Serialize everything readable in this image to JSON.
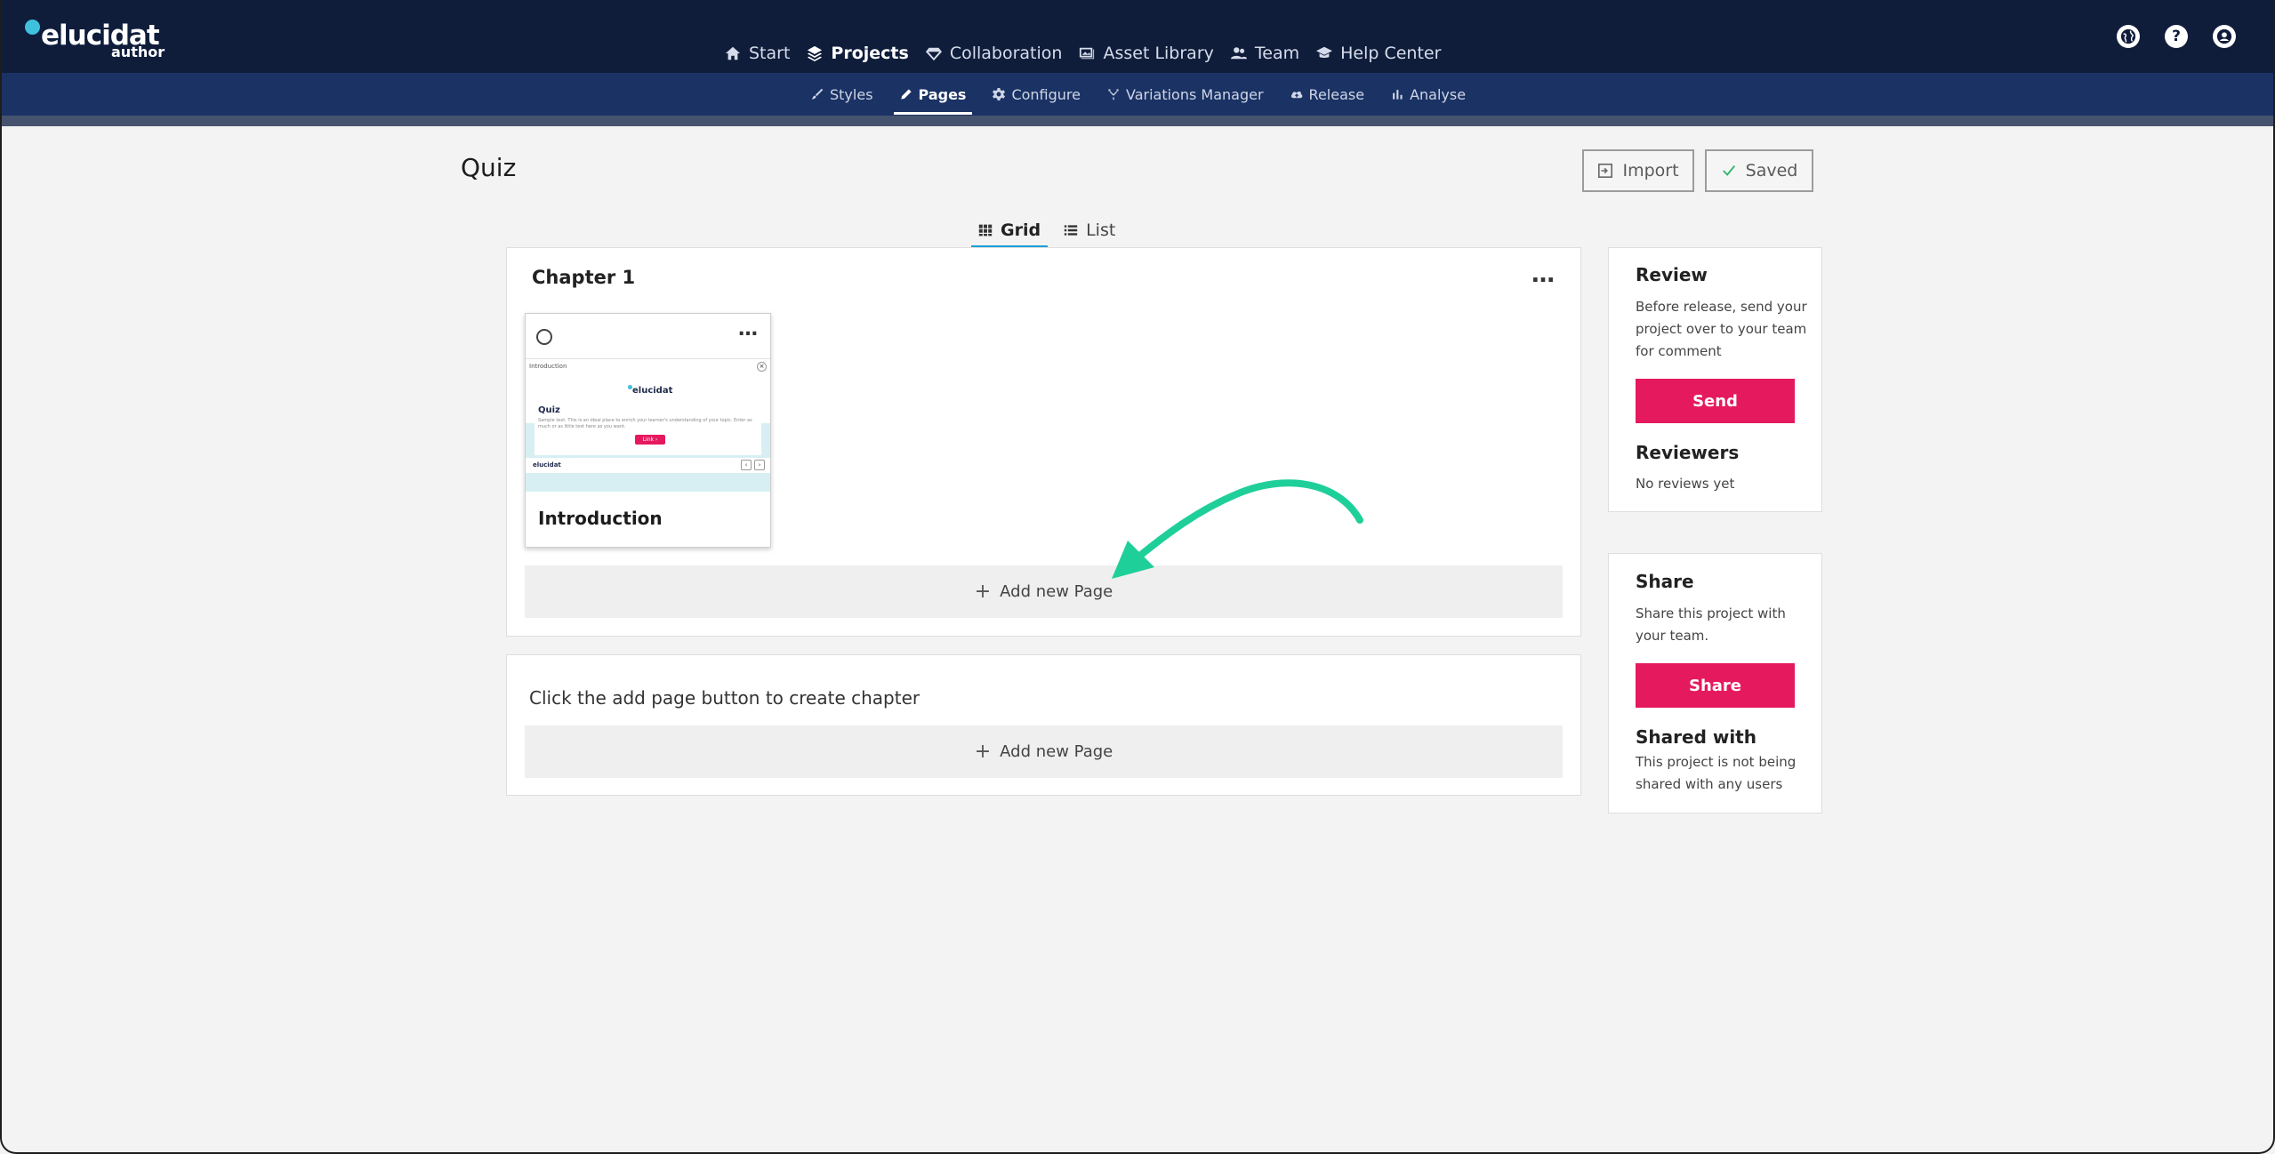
{
  "app": {
    "logo_main": "elucidat",
    "logo_sub": "author"
  },
  "main_nav": [
    {
      "label": "Start",
      "icon": "home-icon"
    },
    {
      "label": "Projects",
      "icon": "layers-icon",
      "active": true
    },
    {
      "label": "Collaboration",
      "icon": "diamond-icon"
    },
    {
      "label": "Asset Library",
      "icon": "images-icon"
    },
    {
      "label": "Team",
      "icon": "users-icon"
    },
    {
      "label": "Help Center",
      "icon": "graduation-cap-icon"
    }
  ],
  "utility_icons": [
    "globe-icon",
    "help-icon",
    "account-icon"
  ],
  "sub_nav": [
    {
      "label": "Styles",
      "icon": "brush-icon"
    },
    {
      "label": "Pages",
      "icon": "pencil-icon",
      "active": true
    },
    {
      "label": "Configure",
      "icon": "gear-icon"
    },
    {
      "label": "Variations Manager",
      "icon": "fork-icon"
    },
    {
      "label": "Release",
      "icon": "cloud-upload-icon"
    },
    {
      "label": "Analyse",
      "icon": "bar-chart-icon"
    }
  ],
  "page": {
    "title": "Quiz",
    "import_label": "Import",
    "saved_label": "Saved"
  },
  "view_tabs": [
    {
      "label": "Grid",
      "icon": "grid-icon",
      "active": true
    },
    {
      "label": "List",
      "icon": "list-icon"
    }
  ],
  "chapter": {
    "title": "Chapter 1",
    "more": "…"
  },
  "page_card": {
    "title": "Introduction",
    "thumb": {
      "top_label": "Introduction",
      "logo": "elucidat",
      "heading": "Quiz",
      "body": "Sample text. This is an ideal place to enrich your learner's understanding of your topic. Enter as much or as little text here as you want.",
      "button": "Link ›",
      "footer_logo": "elucidat"
    }
  },
  "add_page_label": "Add new Page",
  "empty_chapter_hint": "Click the add page button to create chapter",
  "review": {
    "heading": "Review",
    "text": "Before release, send your project over to your team for comment",
    "button": "Send",
    "reviewers_heading": "Reviewers",
    "reviewers_text": "No reviews yet"
  },
  "share": {
    "heading": "Share",
    "text": "Share this project with your team.",
    "button": "Share",
    "shared_heading": "Shared with",
    "shared_text": "This project is not being shared with any users"
  },
  "colors": {
    "nav_bg": "#0f1d3b",
    "subnav_bg": "#1a3264",
    "accent_pink": "#e5195e",
    "tab_underline": "#1aa1d6",
    "annotation_arrow": "#1fcf9a"
  }
}
